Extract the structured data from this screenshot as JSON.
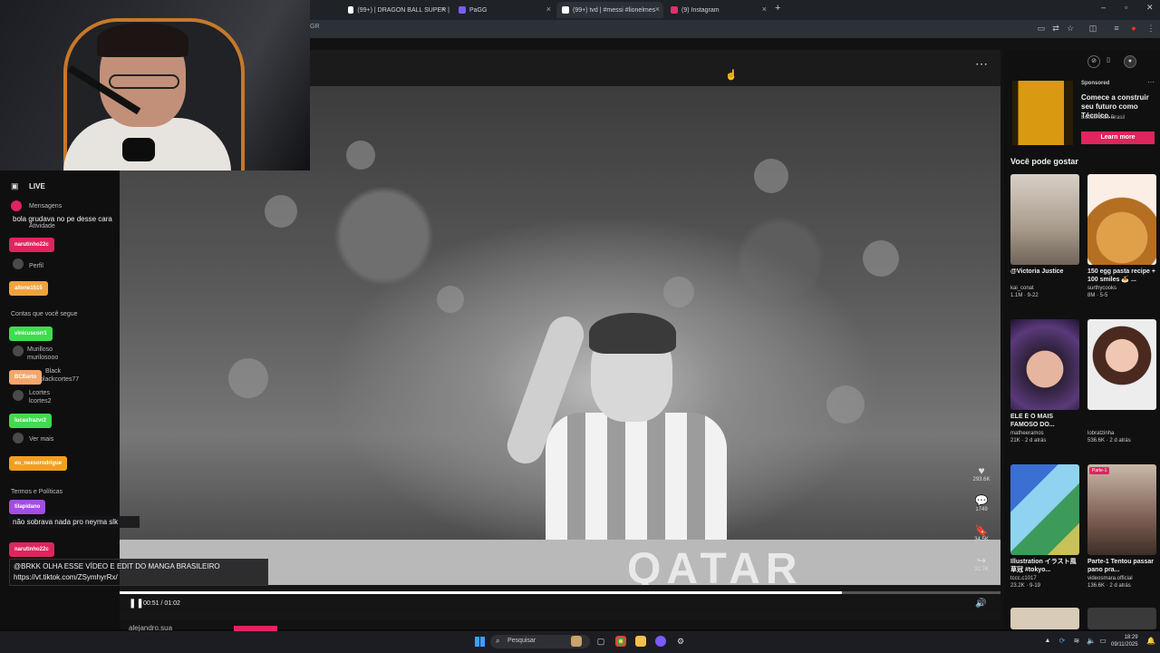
{
  "browser": {
    "tabs": [
      {
        "label": "(99+) | DRAGON BALL SUPER |",
        "color": "#ffffff"
      },
      {
        "label": "PaGG",
        "color": "#7a5cff"
      },
      {
        "label": "(99+) tvd | #messi #lionelmes",
        "color": "#ffffff"
      },
      {
        "label": "(9) Instagram",
        "color": "#e1306c"
      }
    ],
    "new_tab": "+",
    "address_fragment": "GR"
  },
  "video": {
    "more": "⋯",
    "stadium_text": "QATAR",
    "actions": [
      {
        "icon": "♥",
        "count": "293.6K"
      },
      {
        "icon": "💬",
        "count": "1749"
      },
      {
        "icon": "🔖",
        "count": "34.5K"
      },
      {
        "icon": "↪",
        "count": "32.7K"
      }
    ],
    "time": "00:51 / 01:02",
    "progress": 0.82,
    "below_author": "alejandro.sua"
  },
  "sidebar": {
    "ad": {
      "sponsored": "Sponsored",
      "title": "Comece a construir seu futuro como Técnico...",
      "brand": "Educa Mais Brasil",
      "cta": "Learn more"
    },
    "rec_title": "Você pode gostar",
    "cards": [
      {
        "title": "@Victoria Justice",
        "author": "kai_conat",
        "stats": "1.1M · 9-22",
        "tag": ""
      },
      {
        "title": "150 egg pasta recipe + 100 smiles 🍝 ...",
        "author": "surthycooks",
        "stats": "8M · 5-5",
        "tag": ""
      },
      {
        "title": "ELE É O MAIS FAMOSO DO...",
        "author": "matheeramos",
        "stats": "21K · 2 d atrás",
        "tag": ""
      },
      {
        "title": "",
        "author": "lobratzinha",
        "stats": "536.6K · 2 d atrás",
        "tag": ""
      },
      {
        "title": "Illustration イラスト風 草冠 #tokyo...",
        "author": "tccc.c1017",
        "stats": "23.2K · 9-19",
        "tag": ""
      },
      {
        "title": "Parte-1 Tentou passar pano pra...",
        "author": "videosmara.official",
        "stats": "136.6K · 2 d atrás",
        "tag": "Parte-1"
      }
    ]
  },
  "chat": {
    "live": "LIVE",
    "ghost_menu": [
      "Mensagens",
      "Atividade",
      "Perfil",
      "Contas que você segue",
      "Ver mais",
      "Termos e Políticas"
    ],
    "ghost_follows": [
      "Murilloso",
      "murilosooo",
      "Black",
      "blackcortes77",
      "Lcortes",
      "lcortes2"
    ],
    "lines": [
      {
        "name": "",
        "msg": "bola grudava no pe desse cara",
        "color": ""
      },
      {
        "name": "narutinho22c",
        "msg": "",
        "color": "#e0245e"
      },
      {
        "name": "allone1515",
        "msg": "",
        "color": "#f1a33b"
      },
      {
        "name": "vinicuscorr1",
        "msg": "",
        "color": "#3fdc4f"
      },
      {
        "name": "BCBarto",
        "msg": "",
        "color": "#f6a66b"
      },
      {
        "name": "lucasfrazvr2",
        "msg": "",
        "color": "#3fdc4f"
      },
      {
        "name": "eu_neesorodrigue",
        "msg": "",
        "color": "#f0a020"
      },
      {
        "name": "tilapidano",
        "msg": "não sobrava nada pro neyma slk",
        "color": "#a34ee0"
      },
      {
        "name": "narutinho22c",
        "msg": "@BRKK OLHA ESSE VÍDEO E EDIT DO MANGA BRASILEIRO https://vt.tiktok.com/ZSymhyrRx/",
        "color": "#e0245e"
      }
    ]
  },
  "taskbar": {
    "search": "Pesquisar",
    "time": "18:29",
    "date": "09/11/2025"
  }
}
